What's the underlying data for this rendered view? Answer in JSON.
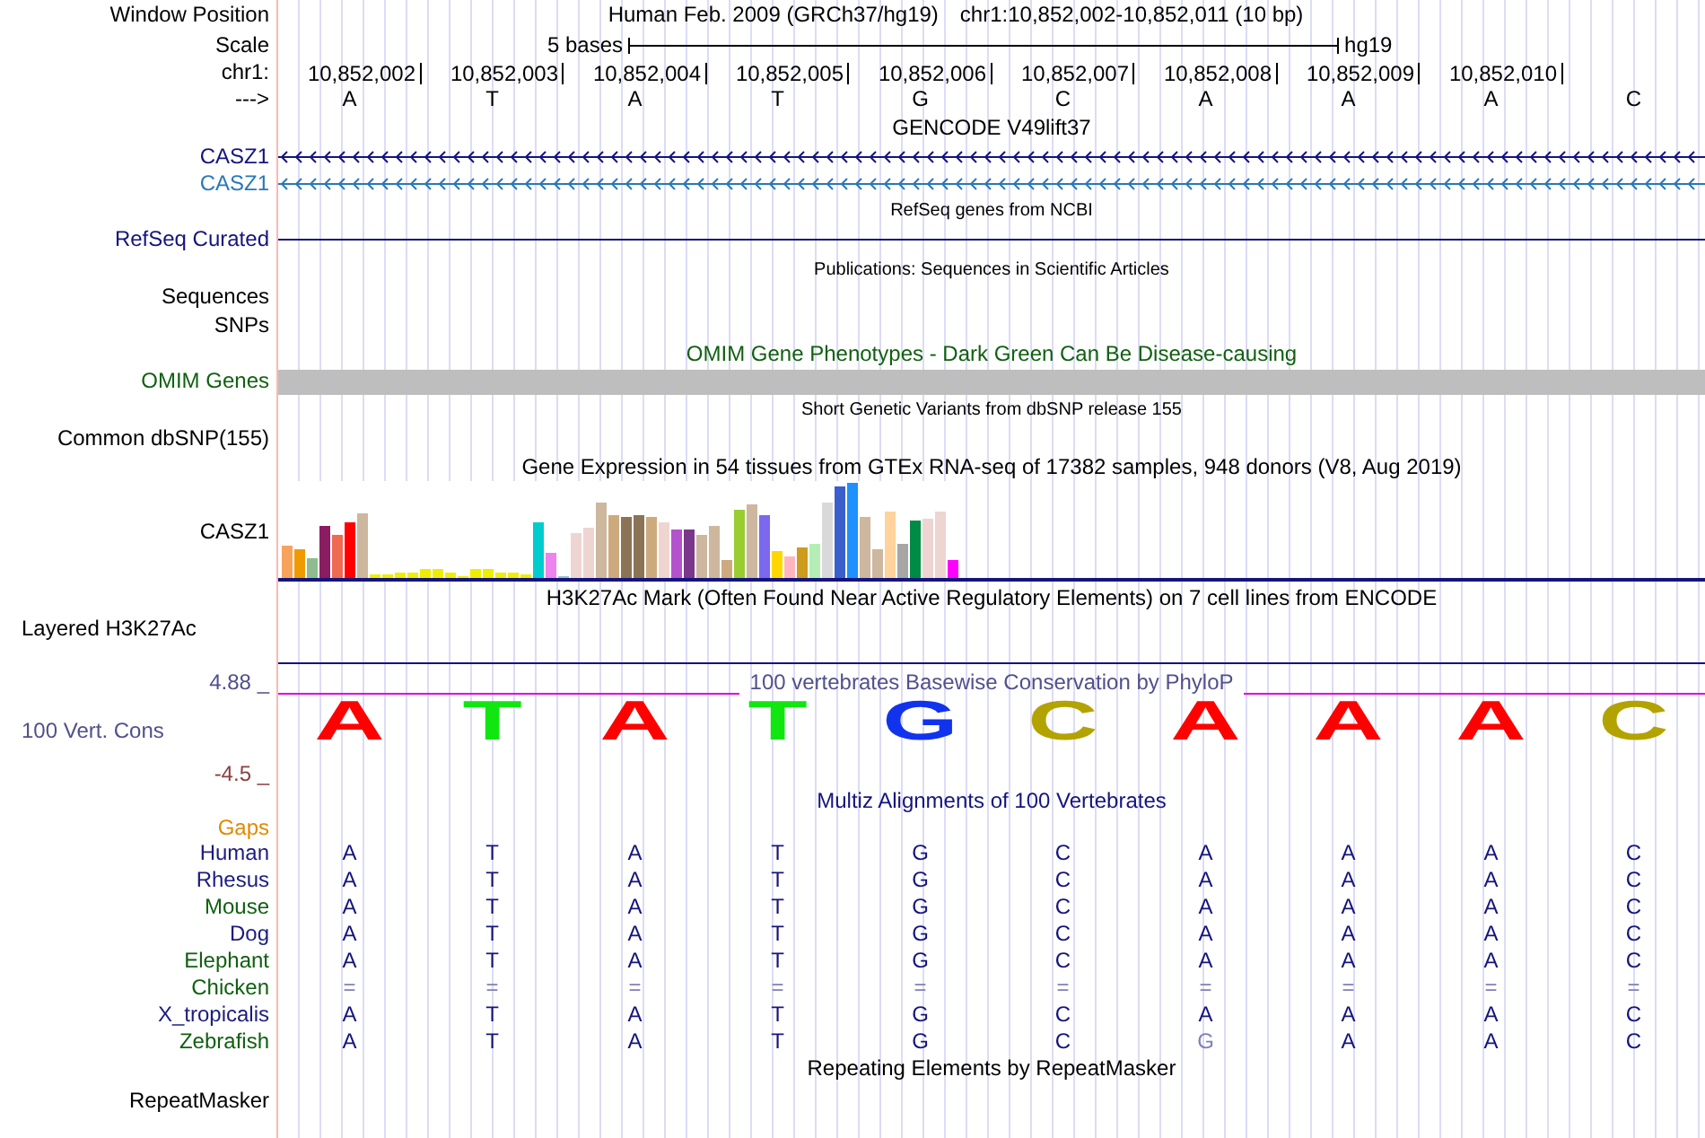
{
  "position": {
    "label": "Window Position",
    "title": "Human Feb. 2009 (GRCh37/hg19)",
    "range": "chr1:10,852,002-10,852,011 (10 bp)"
  },
  "scale": {
    "label": "Scale",
    "text": "5 bases",
    "assembly": "hg19"
  },
  "coordinates": {
    "label": "chr1:",
    "ticks": [
      "10,852,002",
      "10,852,003",
      "10,852,004",
      "10,852,005",
      "10,852,006",
      "10,852,007",
      "10,852,008",
      "10,852,009",
      "10,852,010"
    ]
  },
  "sequence": {
    "label": "--->",
    "bases": [
      "A",
      "T",
      "A",
      "T",
      "G",
      "C",
      "A",
      "A",
      "A",
      "C"
    ]
  },
  "gencode": {
    "title": "GENCODE V49lift37",
    "genes": [
      {
        "name": "CASZ1",
        "color": "#14147e"
      },
      {
        "name": "CASZ1",
        "color": "#2a78b8"
      }
    ]
  },
  "refseq": {
    "title": "RefSeq genes from NCBI",
    "label": "RefSeq Curated"
  },
  "publications": {
    "title": "Publications: Sequences in Scientific Articles",
    "label": "Sequences"
  },
  "snps": {
    "label": "SNPs"
  },
  "omim": {
    "title": "OMIM Gene Phenotypes - Dark Green Can Be Disease-causing",
    "label": "OMIM Genes"
  },
  "dbsnp": {
    "title": "Short Genetic Variants from dbSNP release 155",
    "label": "Common dbSNP(155)"
  },
  "gtex": {
    "title": "Gene Expression in 54 tissues from GTEx RNA-seq of 17382 samples, 948 donors (V8, Aug 2019)",
    "label": "CASZ1"
  },
  "h3k27ac": {
    "title": "H3K27Ac Mark (Often Found Near Active Regulatory Elements) on 7 cell lines from ENCODE",
    "label": "Layered H3K27Ac"
  },
  "conservation": {
    "title": "100 vertebrates Basewise Conservation by PhyloP",
    "label": "100 Vert. Cons",
    "max": "4.88 _",
    "min": "-4.5 _",
    "logo": [
      {
        "base": "A",
        "color": "#ff0000"
      },
      {
        "base": "T",
        "color": "#11e611"
      },
      {
        "base": "A",
        "color": "#ff0000"
      },
      {
        "base": "T",
        "color": "#11e611"
      },
      {
        "base": "G",
        "color": "#1133ee"
      },
      {
        "base": "C",
        "color": "#b3a300"
      },
      {
        "base": "A",
        "color": "#ff0000"
      },
      {
        "base": "A",
        "color": "#ff0000"
      },
      {
        "base": "A",
        "color": "#ff0000"
      },
      {
        "base": "C",
        "color": "#b3a300"
      }
    ]
  },
  "multiz": {
    "title": "Multiz Alignments of 100 Vertebrates",
    "gaps_label": "Gaps",
    "species": [
      {
        "name": "Human",
        "color": "#1c1c80",
        "bases": [
          "A",
          "T",
          "A",
          "T",
          "G",
          "C",
          "A",
          "A",
          "A",
          "C"
        ],
        "faded": [
          false,
          false,
          false,
          false,
          false,
          false,
          false,
          false,
          false,
          false
        ]
      },
      {
        "name": "Rhesus",
        "color": "#1c1c80",
        "bases": [
          "A",
          "T",
          "A",
          "T",
          "G",
          "C",
          "A",
          "A",
          "A",
          "C"
        ],
        "faded": [
          false,
          false,
          false,
          false,
          false,
          false,
          false,
          false,
          false,
          false
        ]
      },
      {
        "name": "Mouse",
        "color": "#106010",
        "bases": [
          "A",
          "T",
          "A",
          "T",
          "G",
          "C",
          "A",
          "A",
          "A",
          "C"
        ],
        "faded": [
          false,
          false,
          false,
          false,
          false,
          false,
          false,
          false,
          false,
          false
        ]
      },
      {
        "name": "Dog",
        "color": "#1c1c80",
        "bases": [
          "A",
          "T",
          "A",
          "T",
          "G",
          "C",
          "A",
          "A",
          "A",
          "C"
        ],
        "faded": [
          false,
          false,
          false,
          false,
          false,
          false,
          false,
          false,
          false,
          false
        ]
      },
      {
        "name": "Elephant",
        "color": "#106010",
        "bases": [
          "A",
          "T",
          "A",
          "T",
          "G",
          "C",
          "A",
          "A",
          "A",
          "C"
        ],
        "faded": [
          false,
          false,
          false,
          false,
          false,
          false,
          false,
          false,
          false,
          false
        ]
      },
      {
        "name": "Chicken",
        "color": "#106010",
        "bases": [
          "=",
          "=",
          "=",
          "=",
          "=",
          "=",
          "=",
          "=",
          "=",
          "="
        ],
        "faded": [
          true,
          true,
          true,
          true,
          true,
          true,
          true,
          true,
          true,
          true
        ]
      },
      {
        "name": "X_tropicalis",
        "color": "#1c1c80",
        "bases": [
          "A",
          "T",
          "A",
          "T",
          "G",
          "C",
          "A",
          "A",
          "A",
          "C"
        ],
        "faded": [
          false,
          false,
          false,
          false,
          false,
          false,
          false,
          false,
          false,
          false
        ]
      },
      {
        "name": "Zebrafish",
        "color": "#106010",
        "bases": [
          "A",
          "T",
          "A",
          "T",
          "G",
          "C",
          "G",
          "A",
          "A",
          "C"
        ],
        "faded": [
          false,
          false,
          false,
          false,
          false,
          false,
          true,
          false,
          false,
          false
        ]
      }
    ]
  },
  "repeatmasker": {
    "title": "Repeating Elements by RepeatMasker",
    "label": "RepeatMasker"
  }
}
